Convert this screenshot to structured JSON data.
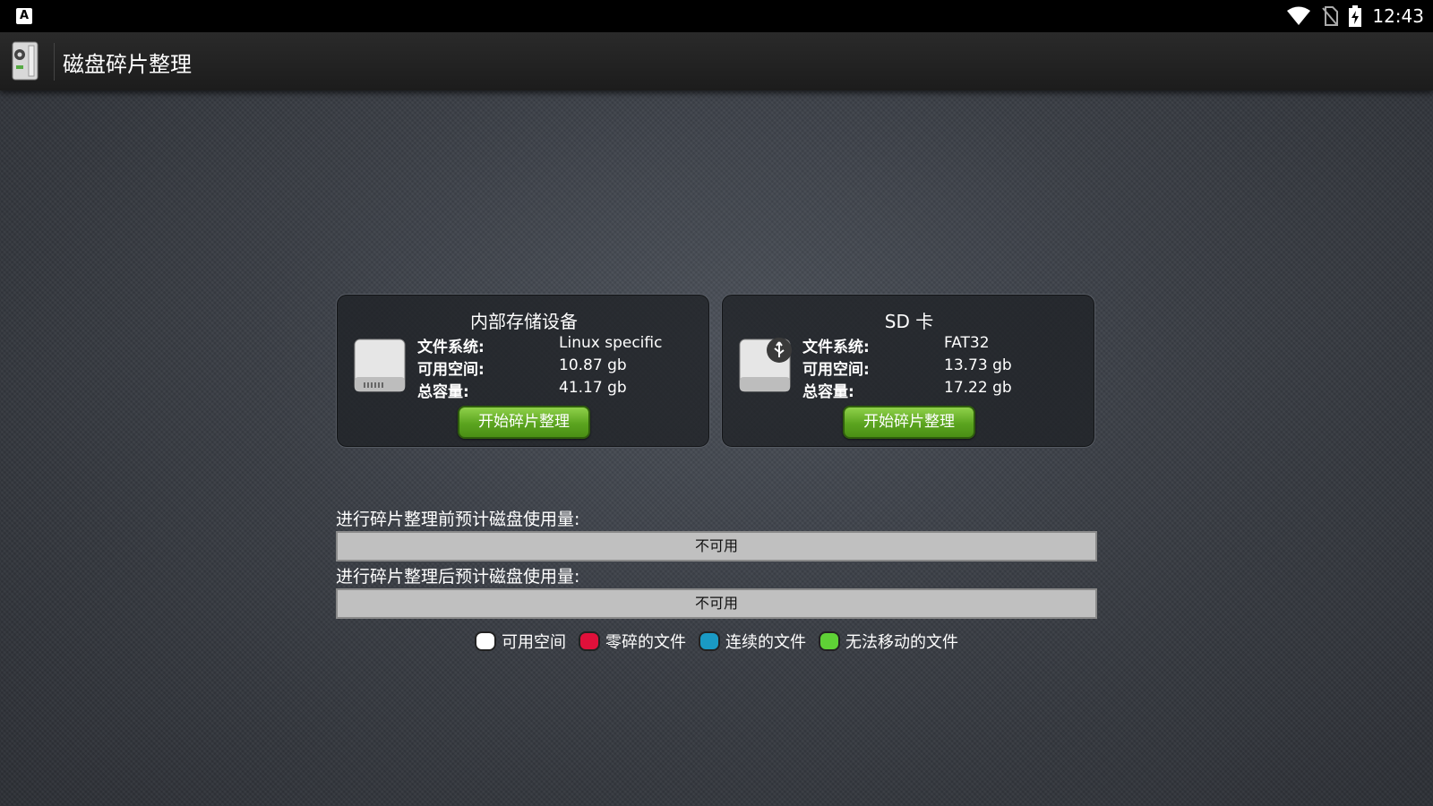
{
  "status_bar": {
    "notification_icon": "A",
    "time": "12:43",
    "icons": [
      "wifi-icon",
      "no-sim-icon",
      "battery-charging-icon"
    ]
  },
  "app_bar": {
    "title": "磁盘碎片整理",
    "icon": "defrag-app-icon"
  },
  "devices": [
    {
      "title": "内部存储设备",
      "icon": "hard-drive-icon",
      "fs_label": "文件系统:",
      "fs_value": "Linux specific",
      "free_label": "可用空间:",
      "free_value": "10.87 gb",
      "total_label": "总容量:",
      "total_value": "41.17 gb",
      "button_label": "开始碎片整理"
    },
    {
      "title": "SD 卡",
      "icon": "usb-drive-icon",
      "fs_label": "文件系统:",
      "fs_value": "FAT32",
      "free_label": "可用空间:",
      "free_value": "13.73 gb",
      "total_label": "总容量:",
      "total_value": "17.22 gb",
      "button_label": "开始碎片整理"
    }
  ],
  "usage": {
    "before_label": "进行碎片整理前预计磁盘使用量:",
    "before_value": "不可用",
    "after_label": "进行碎片整理后预计磁盘使用量:",
    "after_value": "不可用"
  },
  "legend": [
    {
      "label": "可用空间",
      "color": "#ffffff"
    },
    {
      "label": "零碎的文件",
      "color": "#e0103a"
    },
    {
      "label": "连续的文件",
      "color": "#1a9ac4"
    },
    {
      "label": "无法移动的文件",
      "color": "#5fd136"
    }
  ]
}
